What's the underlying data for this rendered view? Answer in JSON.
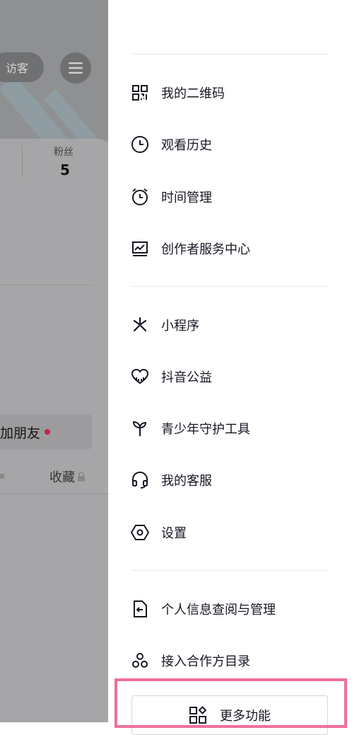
{
  "background": {
    "visitor_label": "访客",
    "fans_label": "粉丝",
    "fans_count": "5",
    "add_friend_label": "加朋友",
    "favorites_label": "收藏"
  },
  "drawer": {
    "groups": [
      [
        {
          "label": "我的二维码",
          "icon": "qr-code-icon"
        },
        {
          "label": "观看历史",
          "icon": "clock-icon"
        },
        {
          "label": "时间管理",
          "icon": "alarm-clock-icon"
        },
        {
          "label": "创作者服务中心",
          "icon": "chart-monitor-icon"
        }
      ],
      [
        {
          "label": "小程序",
          "icon": "mini-program-icon"
        },
        {
          "label": "抖音公益",
          "icon": "heart-charity-icon"
        },
        {
          "label": "青少年守护工具",
          "icon": "sprout-icon"
        },
        {
          "label": "我的客服",
          "icon": "headset-icon"
        },
        {
          "label": "设置",
          "icon": "settings-hexagon-icon"
        }
      ],
      [
        {
          "label": "个人信息查阅与管理",
          "icon": "document-info-icon"
        },
        {
          "label": "接入合作方目录",
          "icon": "partners-icon"
        }
      ]
    ],
    "more_button_label": "更多功能"
  },
  "colors": {
    "highlight": "#ee6f9c",
    "text": "#161823",
    "divider": "#e9e9e9",
    "notification_dot": "#c0283e"
  }
}
